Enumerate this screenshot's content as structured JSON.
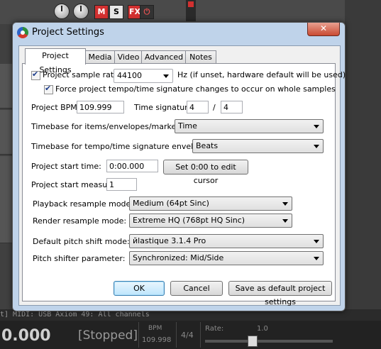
{
  "dialog": {
    "title": "Project Settings",
    "close_glyph": "✕",
    "tabs": [
      {
        "label": "Project Settings"
      },
      {
        "label": "Media"
      },
      {
        "label": "Video"
      },
      {
        "label": "Advanced"
      },
      {
        "label": "Notes"
      }
    ],
    "sample_rate": {
      "checked": true,
      "label": "Project sample rate:",
      "value": "44100",
      "hint": "Hz (if unset, hardware default will be used)"
    },
    "force_tempo": {
      "checked": true,
      "label": "Force project tempo/time signature changes to occur on whole samples"
    },
    "bpm": {
      "label": "Project BPM:",
      "value": "109.999"
    },
    "time_signature": {
      "label": "Time signature",
      "numerator": "4",
      "separator": "/",
      "denominator": "4"
    },
    "timebase_items": {
      "label": "Timebase for items/envelopes/markers:",
      "value": "Time"
    },
    "timebase_tempo": {
      "label": "Timebase for tempo/time signature envelope:",
      "value": "Beats"
    },
    "start_time": {
      "label": "Project start time:",
      "value": "0:00.000",
      "button": "Set 0:00 to edit cursor"
    },
    "start_measure": {
      "label": "Project start measure:",
      "value": "1"
    },
    "playback_resample": {
      "label": "Playback resample mode:",
      "value": "Medium (64pt Sinc)"
    },
    "render_resample": {
      "label": "Render resample mode:",
      "value": "Extreme HQ (768pt HQ Sinc)"
    },
    "pitch_mode": {
      "label": "Default pitch shift mode:",
      "value": "йlastique 3.1.4 Pro"
    },
    "pitch_param": {
      "label": "Pitch shifter parameter:",
      "value": "Synchronized:  Mid/Side"
    },
    "buttons": {
      "ok": "OK",
      "cancel": "Cancel",
      "save_default": "Save as default project settings"
    }
  },
  "background": {
    "track_buttons": {
      "mute": "M",
      "solo": "S",
      "fx": "FX",
      "power": "⏻"
    },
    "status_line": "t] MIDI: USB Axiom 49: All channels",
    "transport": {
      "time": "0.000",
      "state": "[Stopped]",
      "bpm_label": "BPM",
      "bpm_value": "109.998",
      "signature": "4/4",
      "rate_label": "Rate:",
      "rate_value": "1.0"
    }
  },
  "colors": {
    "record_red": "#d23030",
    "dialog_frame": "#bfd3ea",
    "panel_white": "#ffffff"
  }
}
